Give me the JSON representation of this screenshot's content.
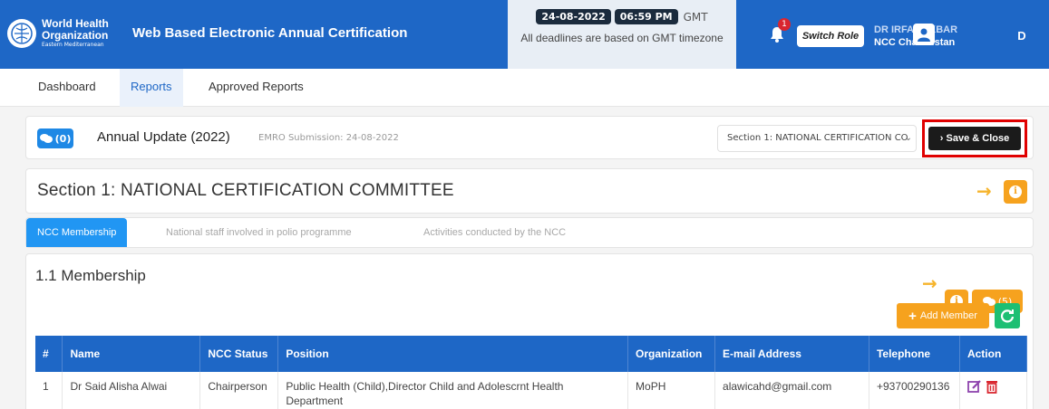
{
  "header": {
    "logo_line1": "World Health",
    "logo_line2": "Organization",
    "logo_line3": "Eastern Mediterranean",
    "app_title": "Web Based Electronic Annual Certification",
    "date": "24-08-2022",
    "time": "06:59 PM",
    "tz": "GMT",
    "deadline_note": "All deadlines are based on GMT timezone",
    "notification_count": "1",
    "switch_role_label": "Switch Role",
    "user_line1": "DR IRFA      I AKBAR",
    "user_line2": "NCC Cha       anistan",
    "user_menu_letter": "D"
  },
  "nav": {
    "items": [
      {
        "label": "Dashboard"
      },
      {
        "label": "Reports"
      },
      {
        "label": "Approved Reports"
      }
    ]
  },
  "report": {
    "comment_count": "(0)",
    "title": "Annual Update (2022)",
    "submission": "EMRO Submission: 24-08-2022",
    "section_select": "Section 1: NATIONAL CERTIFICATION CO",
    "save_close_label": "Save & Close"
  },
  "section": {
    "title": "Section 1: NATIONAL CERTIFICATION COMMITTEE",
    "tabs": [
      {
        "label": "NCC Membership"
      },
      {
        "label": "National staff involved in polio programme"
      },
      {
        "label": "Activities conducted by the NCC"
      }
    ]
  },
  "membership": {
    "title": "1.1 Membership",
    "message_count": "(5)",
    "add_label": "Add Member",
    "columns": [
      "#",
      "Name",
      "NCC Status",
      "Position",
      "Organization",
      "E-mail Address",
      "Telephone",
      "Action"
    ],
    "rows": [
      {
        "num": "1",
        "name": "Dr Said Alisha Alwai",
        "status": "Chairperson",
        "position": "Public Health (Child),Director Child and Adolescrnt Health Department",
        "organization": "MoPH",
        "email": "alawicahd@gmail.com",
        "phone": "+93700290136"
      }
    ]
  },
  "colors": {
    "primary": "#1e67c6",
    "accent": "#f6a21e",
    "tab_active": "#2196f3",
    "highlight": "#e00000"
  }
}
